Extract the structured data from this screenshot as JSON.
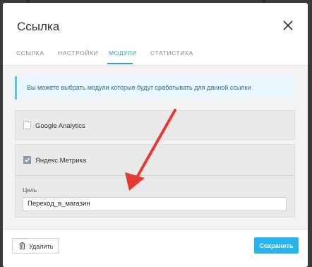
{
  "dialog": {
    "title": "Ссылка"
  },
  "tabs": [
    {
      "label": "ССЫЛКА",
      "active": false
    },
    {
      "label": "НАСТРОЙКИ",
      "active": false
    },
    {
      "label": "МОДУЛИ",
      "active": true
    },
    {
      "label": "СТАТИСТИКА",
      "active": false
    }
  ],
  "alert": {
    "text": "Вы можете выбрать модули которые будут срабатывать для данной ссылки"
  },
  "modules": {
    "google": {
      "label": "Google Analytics",
      "checked": false
    },
    "yandex": {
      "label": "Яндекс.Метрика",
      "checked": true,
      "goal_label": "Цель",
      "goal_value": "Переход_в_магазин"
    }
  },
  "footer": {
    "delete_label": "Удалить",
    "save_label": "Сохранить"
  },
  "colors": {
    "accent": "#27b4ee",
    "annotation_arrow": "#e53935"
  }
}
